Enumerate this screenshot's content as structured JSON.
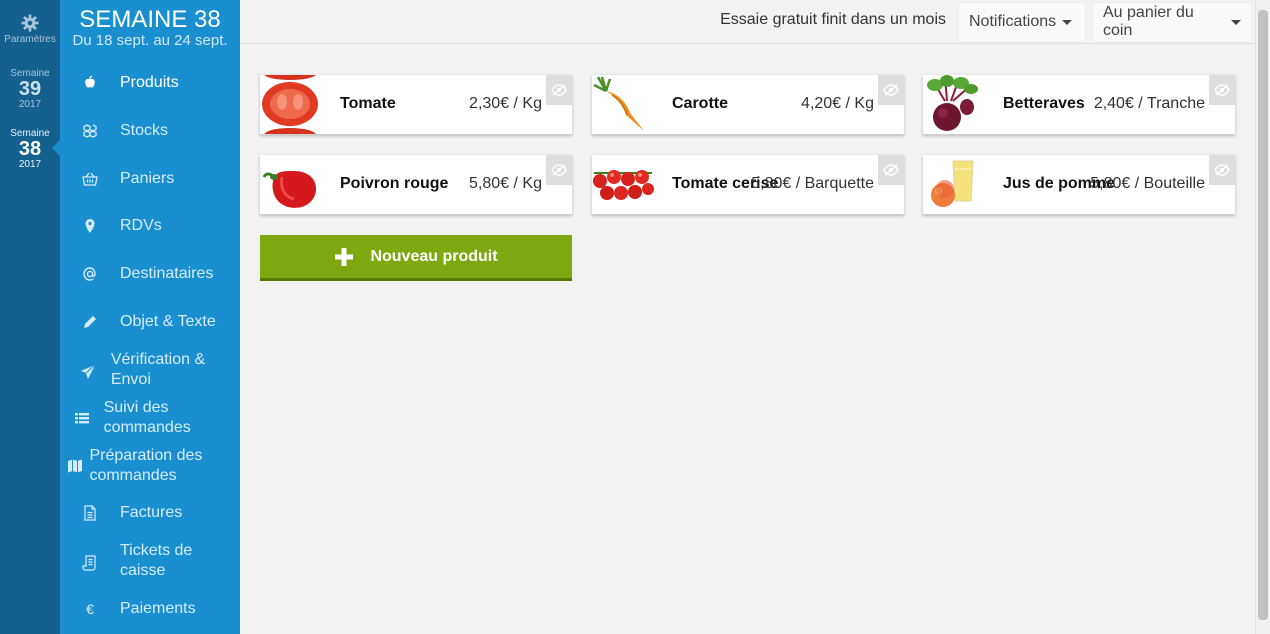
{
  "rail": {
    "settings_label": "Paramètres",
    "weeks": [
      {
        "label": "Semaine",
        "number": "39",
        "year": "2017"
      },
      {
        "label": "Semaine",
        "number": "38",
        "year": "2017"
      }
    ]
  },
  "week": {
    "title": "SEMAINE 38",
    "range": "Du 18 sept. au 24 sept."
  },
  "nav": {
    "items": [
      {
        "label": "Produits",
        "icon": "apple-icon"
      },
      {
        "label": "Stocks",
        "icon": "boxes-icon"
      },
      {
        "label": "Paniers",
        "icon": "basket-icon"
      },
      {
        "label": "RDVs",
        "icon": "map-pin-icon"
      },
      {
        "label": "Destinataires",
        "icon": "at-icon"
      },
      {
        "label": "Objet & Texte",
        "icon": "pencil-icon"
      },
      {
        "label": "Vérification & Envoi",
        "icon": "paper-plane-icon"
      },
      {
        "label": "Suivi des commandes",
        "icon": "list-icon"
      },
      {
        "label": "Préparation des commandes",
        "icon": "map-icon"
      },
      {
        "label": "Factures",
        "icon": "document-icon"
      },
      {
        "label": "Tickets de caisse",
        "icon": "receipt-icon"
      },
      {
        "label": "Paiements",
        "icon": "euro-icon"
      }
    ],
    "active": "Produits"
  },
  "topbar": {
    "trial_text": "Essaie gratuit finit dans un mois",
    "notifications_label": "Notifications",
    "shop_label": "Au panier du coin"
  },
  "products": [
    {
      "name": "Tomate",
      "price": "2,30€ / Kg",
      "image": "tomato-slices"
    },
    {
      "name": "Carotte",
      "price": "4,20€ / Kg",
      "image": "carrot"
    },
    {
      "name": "Betteraves",
      "price": "2,40€ / Tranche",
      "image": "beetroot"
    },
    {
      "name": "Poivron rouge",
      "price": "5,80€ / Kg",
      "image": "red-pepper"
    },
    {
      "name": "Tomate cerise",
      "price": "5,80€ / Barquette",
      "image": "cherry-tomatoes"
    },
    {
      "name": "Jus de pomme",
      "price": "5,80€ / Bouteille",
      "image": "apple-juice"
    }
  ],
  "new_product_label": "Nouveau produit",
  "colors": {
    "rail": "#14608f",
    "nav": "#1a8fd0",
    "accent_green": "#7fa70f",
    "background": "#f2f2f2"
  }
}
